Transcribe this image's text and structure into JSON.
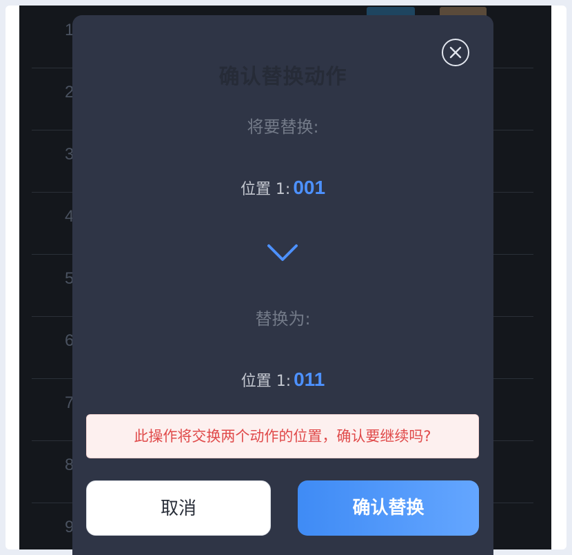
{
  "background_rows": [
    "1",
    "2",
    "3",
    "4",
    "5",
    "6",
    "7",
    "8",
    "9"
  ],
  "dialog": {
    "title": "确认替换动作",
    "from_label": "将要替换:",
    "from_position_label": "位置 1:",
    "from_code": "001",
    "to_label": "替换为:",
    "to_position_label": "位置 1:",
    "to_code": "011",
    "warning": "此操作将交换两个动作的位置，确认要继续吗?",
    "cancel_label": "取消",
    "confirm_label": "确认替换"
  },
  "icons": {
    "close": "close-circle-icon",
    "arrow": "chevron-down-icon"
  },
  "colors": {
    "accent": "#4d91ff",
    "warning_text": "#e04a4a",
    "modal_bg": "#2f3546",
    "overlay_bg": "#14171c"
  }
}
